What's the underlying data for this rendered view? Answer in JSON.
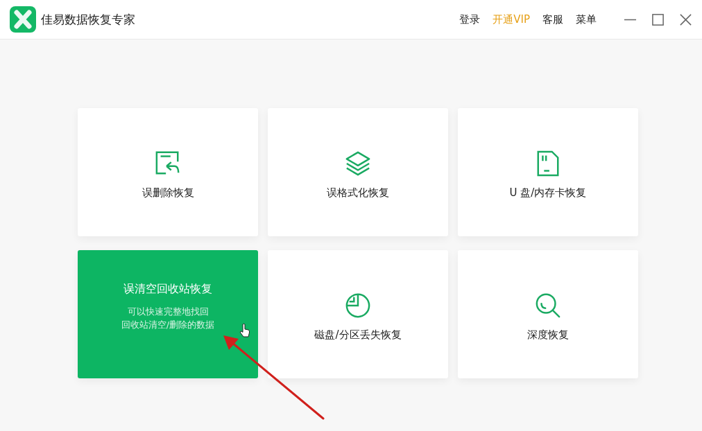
{
  "window": {
    "title": "佳易数据恢复专家"
  },
  "header_links": [
    {
      "label": "登录",
      "highlight": false
    },
    {
      "label": "开通VIP",
      "highlight": true
    },
    {
      "label": "客服",
      "highlight": false
    },
    {
      "label": "菜单",
      "highlight": false
    }
  ],
  "cards": [
    {
      "kind": "delete",
      "label": "误删除恢复",
      "selected": false
    },
    {
      "kind": "format",
      "label": "误格式化恢复",
      "selected": false
    },
    {
      "kind": "card",
      "label": "U 盘/内存卡恢复",
      "selected": false
    },
    {
      "label": "误清空回收站恢复",
      "selected": true,
      "description": [
        "可以快速完整地找回",
        "回收站清空/删除的数据"
      ]
    },
    {
      "kind": "partition",
      "label": "磁盘/分区丢失恢复",
      "selected": false
    },
    {
      "kind": "deep",
      "label": "深度恢复",
      "selected": false
    }
  ]
}
